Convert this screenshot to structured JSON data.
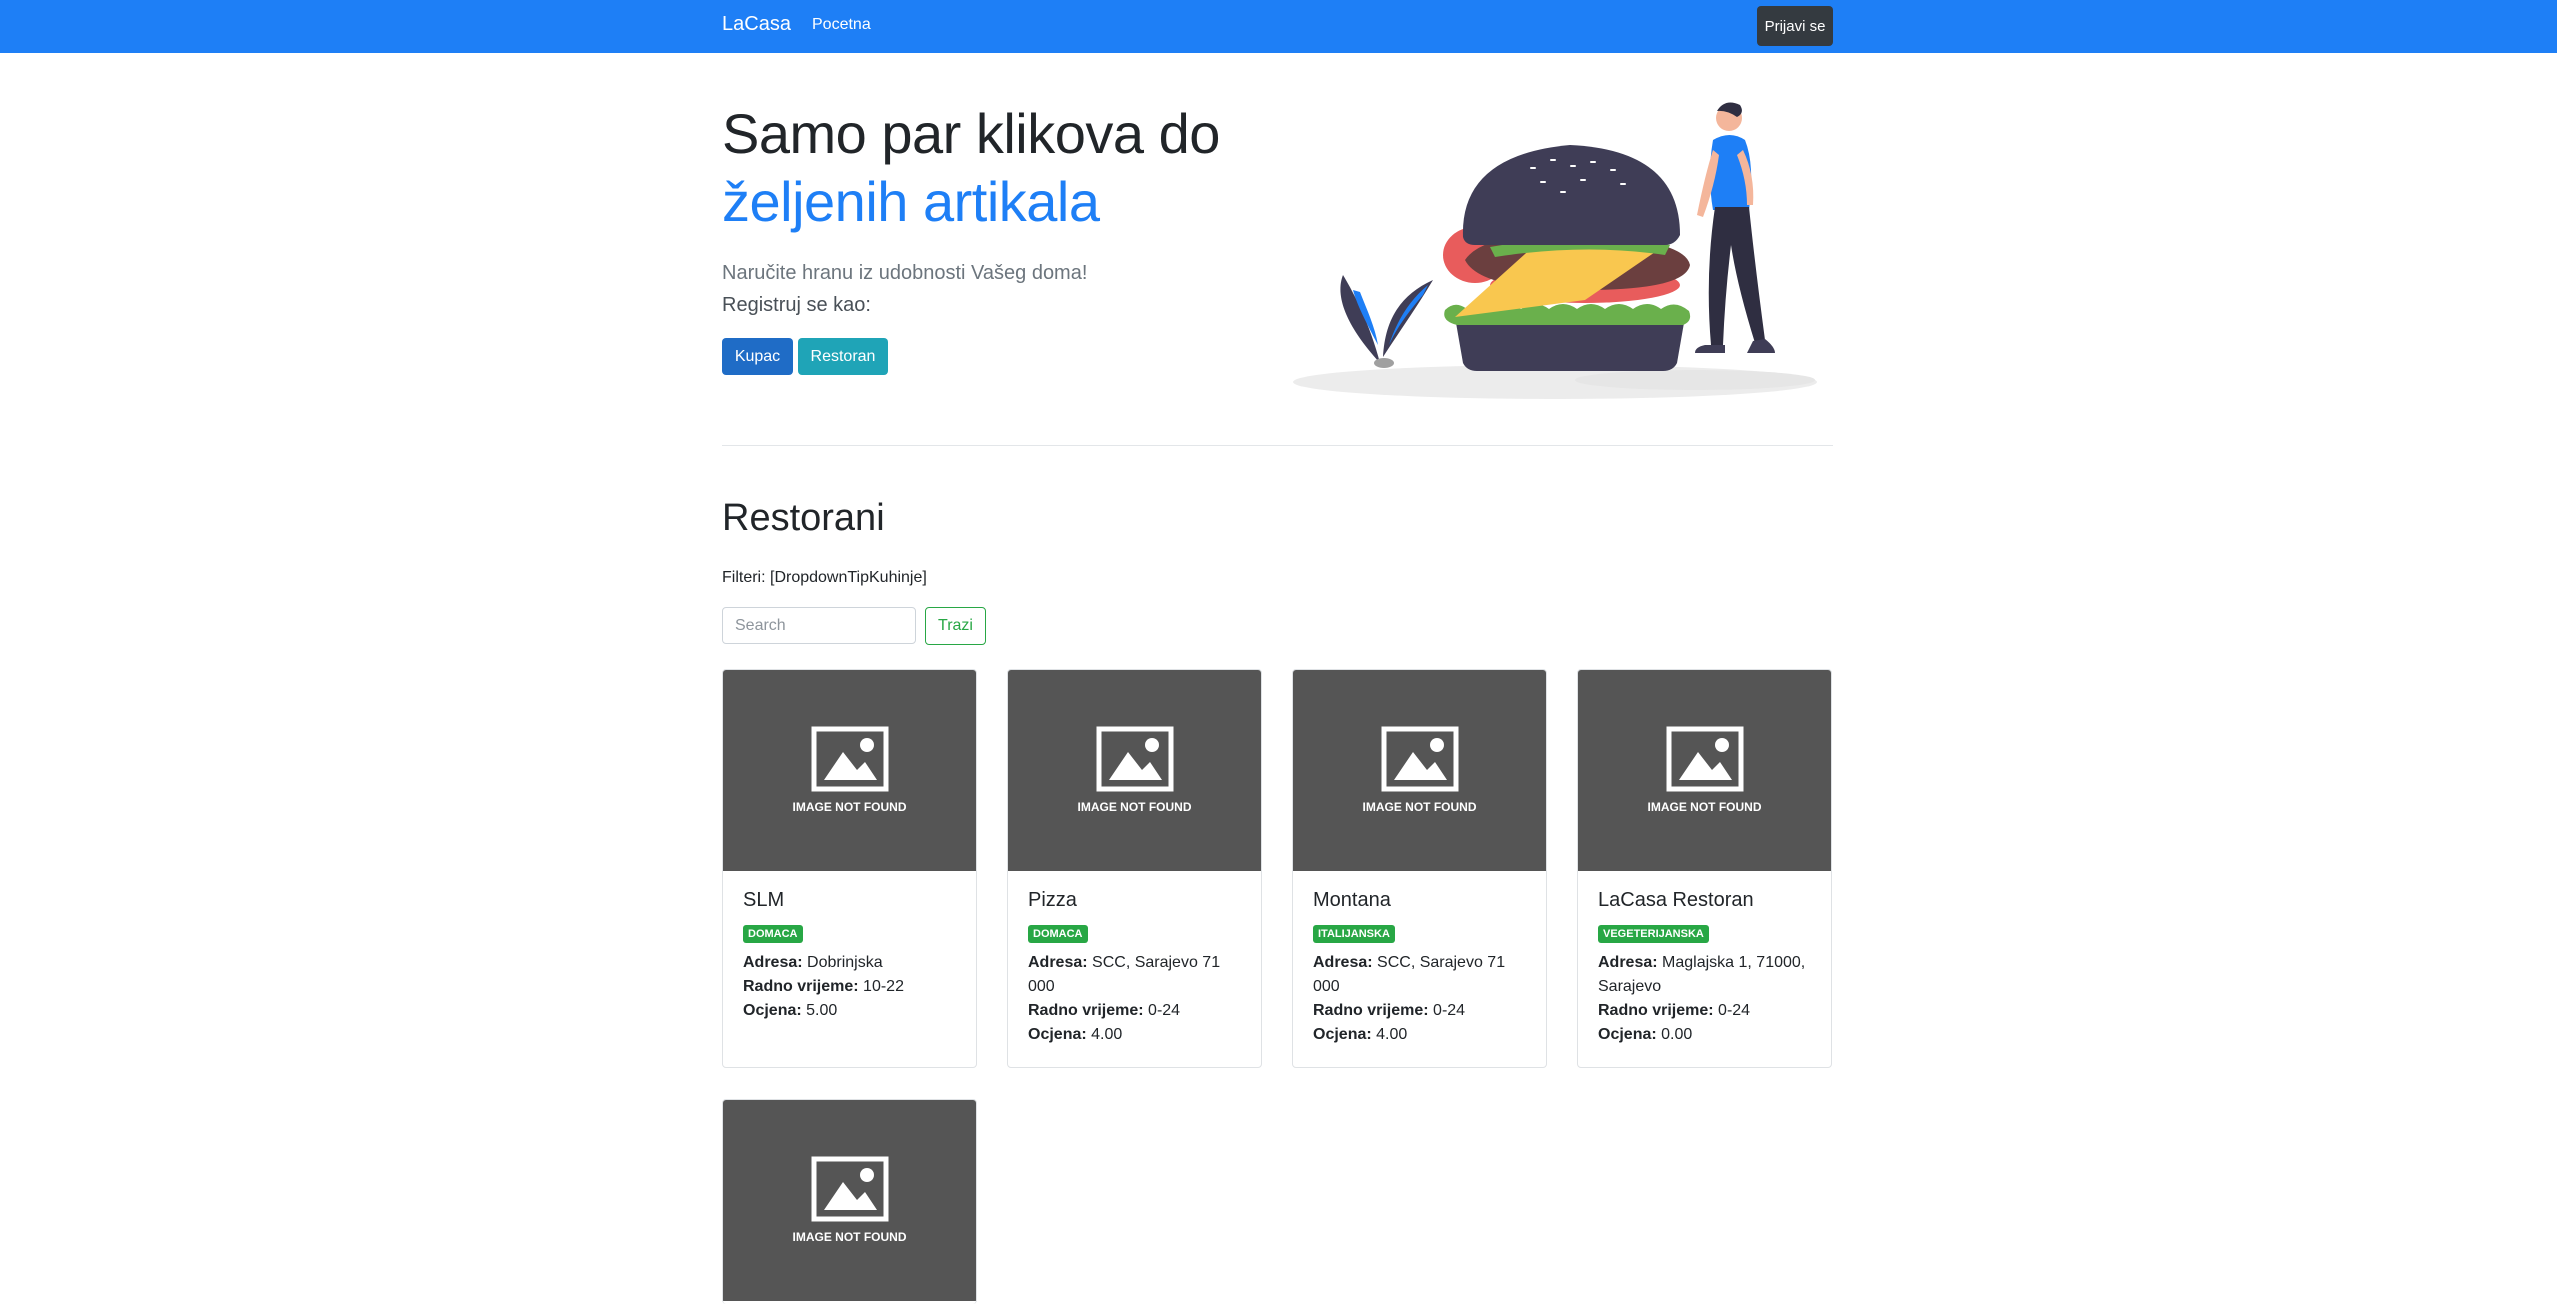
{
  "navbar": {
    "brand": "LaCasa",
    "home": "Pocetna",
    "login": "Prijavi se"
  },
  "hero": {
    "title_line1": "Samo par klikova do",
    "title_line2": "željenih artikala",
    "subtitle": "Naručite hranu iz udobnosti Vašeg doma!",
    "register_label": "Registruj se kao:",
    "buyer_button": "Kupac",
    "restaurant_button": "Restoran"
  },
  "restaurants": {
    "title": "Restorani",
    "filters_label": "Filteri: [DropdownTipKuhinje]",
    "search_placeholder": "Search",
    "search_button": "Trazi",
    "image_not_found": "IMAGE NOT FOUND",
    "address_label": "Adresa:",
    "hours_label": "Radno vrijeme:",
    "rating_label": "Ocjena:",
    "items": [
      {
        "name": "SLM",
        "cuisine": "DOMACA",
        "address": "Dobrinjska",
        "hours": "10-22",
        "rating": "5.00"
      },
      {
        "name": "Pizza",
        "cuisine": "DOMACA",
        "address": "SCC, Sarajevo 71 000",
        "hours": "0-24",
        "rating": "4.00"
      },
      {
        "name": "Montana",
        "cuisine": "ITALIJANSKA",
        "address": "SCC, Sarajevo 71 000",
        "hours": "0-24",
        "rating": "4.00"
      },
      {
        "name": "LaCasa Restoran",
        "cuisine": "VEGETERIJANSKA",
        "address": "Maglajska 1, 71000, Sarajevo",
        "hours": "0-24",
        "rating": "0.00"
      }
    ]
  },
  "colors": {
    "primary": "#1e7ff6",
    "dark": "#343a40",
    "success": "#28a745",
    "info": "#1fa4b7",
    "placeholder_bg": "#555555"
  }
}
